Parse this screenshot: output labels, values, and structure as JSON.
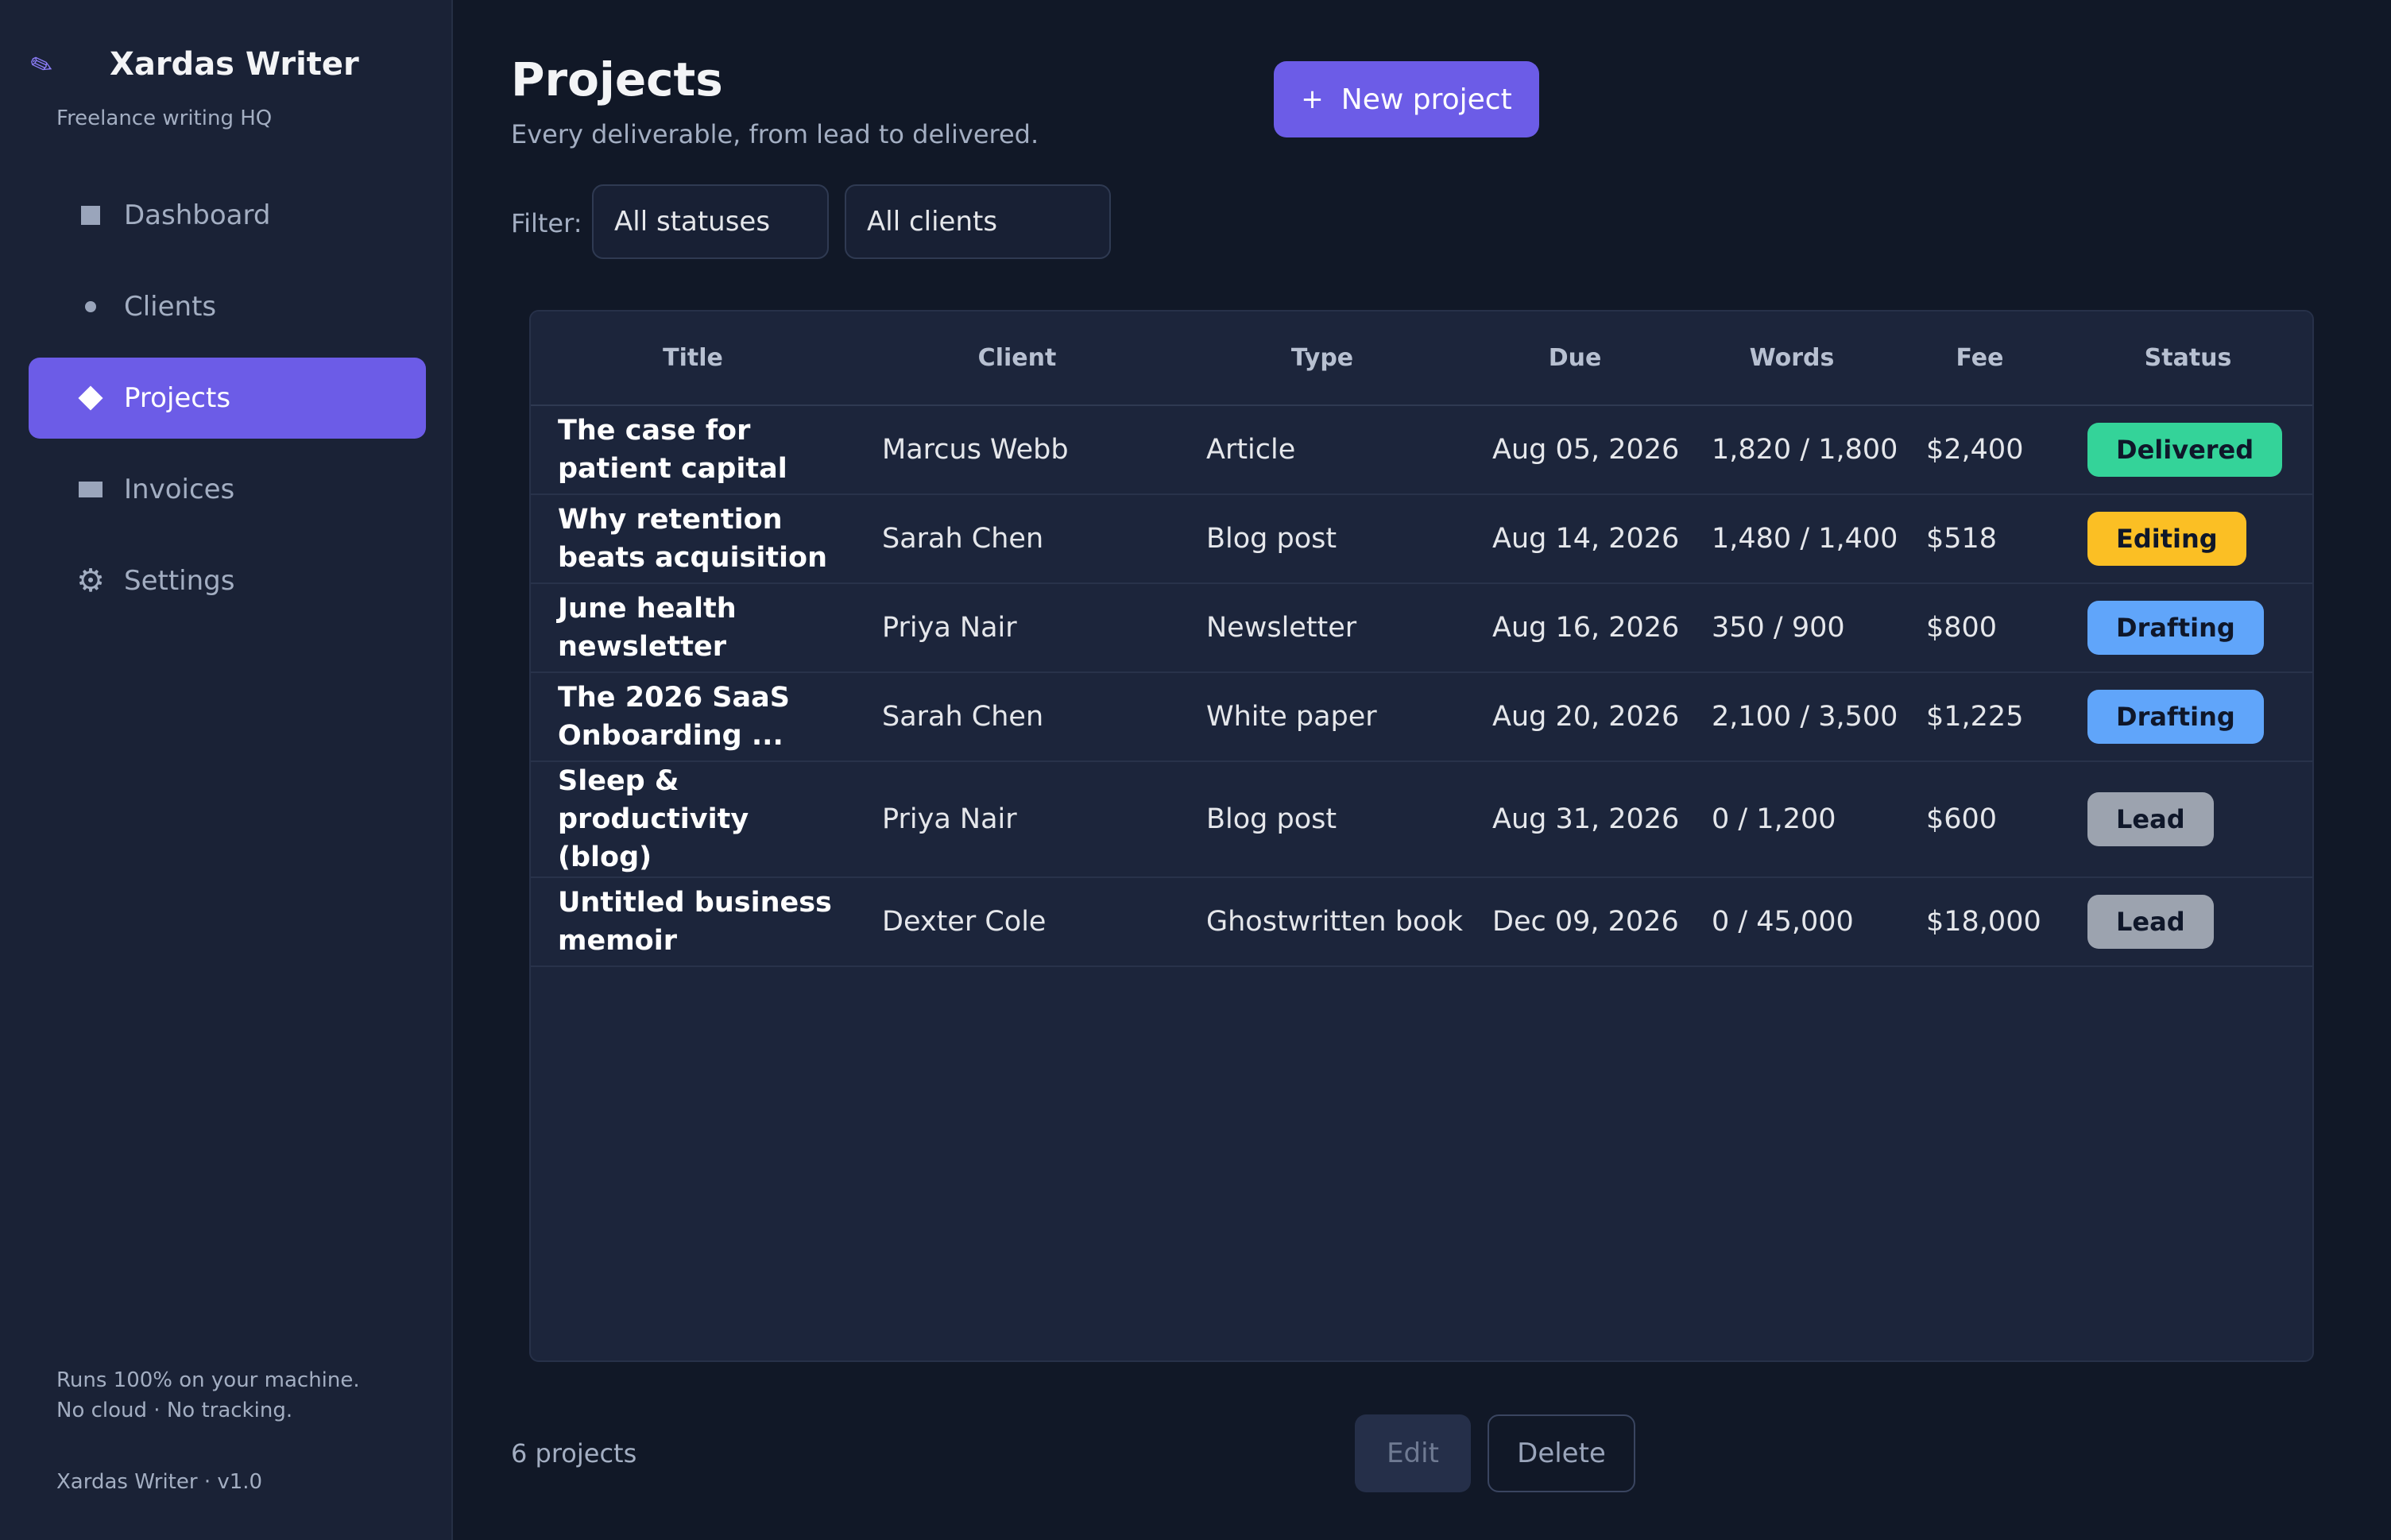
{
  "app": {
    "name": "Xardas Writer",
    "tagline": "Freelance writing HQ",
    "footer_note_line1": "Runs 100% on your machine.",
    "footer_note_line2": "No cloud · No tracking.",
    "version": "Xardas Writer · v1.0"
  },
  "sidebar": {
    "items": [
      {
        "label": "Dashboard",
        "icon": "square-icon",
        "active": false
      },
      {
        "label": "Clients",
        "icon": "dot-icon",
        "active": false
      },
      {
        "label": "Projects",
        "icon": "diamond-icon",
        "active": true
      },
      {
        "label": "Invoices",
        "icon": "rectangle-icon",
        "active": false
      },
      {
        "label": "Settings",
        "icon": "gear-icon",
        "active": false
      }
    ]
  },
  "header": {
    "title": "Projects",
    "subtitle": "Every deliverable, from lead to delivered.",
    "new_button_label": "New project",
    "new_button_icon": "plus-icon"
  },
  "filters": {
    "label": "Filter:",
    "status_value": "All statuses",
    "client_value": "All clients"
  },
  "table": {
    "columns": [
      "Title",
      "Client",
      "Type",
      "Due",
      "Words",
      "Fee",
      "Status"
    ],
    "rows": [
      {
        "title": "The case for patient capital",
        "client": "Marcus Webb",
        "type": "Article",
        "due": "Aug 05, 2026",
        "words": "1,820 / 1,800",
        "fee": "$2,400",
        "status": "Delivered"
      },
      {
        "title": "Why retention beats acquisition",
        "client": "Sarah Chen",
        "type": "Blog post",
        "due": "Aug 14, 2026",
        "words": "1,480 / 1,400",
        "fee": "$518",
        "status": "Editing"
      },
      {
        "title": "June health newsletter",
        "client": "Priya Nair",
        "type": "Newsletter",
        "due": "Aug 16, 2026",
        "words": "350 / 900",
        "fee": "$800",
        "status": "Drafting"
      },
      {
        "title": "The 2026 SaaS Onboarding ...",
        "client": "Sarah Chen",
        "type": "White paper",
        "due": "Aug 20, 2026",
        "words": "2,100 / 3,500",
        "fee": "$1,225",
        "status": "Drafting"
      },
      {
        "title": "Sleep & productivity (blog)",
        "client": "Priya Nair",
        "type": "Blog post",
        "due": "Aug 31, 2026",
        "words": "0 / 1,200",
        "fee": "$600",
        "status": "Lead"
      },
      {
        "title": "Untitled business memoir",
        "client": "Dexter Cole",
        "type": "Ghostwritten book",
        "due": "Dec 09, 2026",
        "words": "0 / 45,000",
        "fee": "$18,000",
        "status": "Lead"
      }
    ]
  },
  "status_colors": {
    "Delivered": "#34d399",
    "Editing": "#fbbf24",
    "Drafting": "#60a5fa",
    "Lead": "#9ca3af"
  },
  "footer": {
    "count": "6 projects",
    "edit_label": "Edit",
    "delete_label": "Delete"
  }
}
